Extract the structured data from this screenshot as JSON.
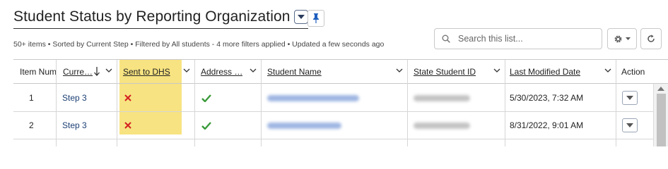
{
  "page": {
    "title": "Student Status by Reporting Organization",
    "subtitle": "50+ items • Sorted by Current Step • Filtered by All students - 4 more filters applied • Updated a few seconds ago"
  },
  "toolbar": {
    "search_placeholder": "Search this list..."
  },
  "columns": [
    {
      "label": "Item Num"
    },
    {
      "label": "Curre…"
    },
    {
      "label": "Sent to DHS"
    },
    {
      "label": "Address …"
    },
    {
      "label": "Student Name"
    },
    {
      "label": "State Student ID"
    },
    {
      "label": "Last Modified Date"
    },
    {
      "label": "Action"
    }
  ],
  "rows": [
    {
      "item": "1",
      "step": "Step 3",
      "sent_to_dhs": "no",
      "address_ok": "yes",
      "modified": "5/30/2023, 7:32 AM"
    },
    {
      "item": "2",
      "step": "Step 3",
      "sent_to_dhs": "no",
      "address_ok": "yes",
      "modified": "8/31/2022, 9:01 AM"
    }
  ],
  "colors": {
    "highlight": "#f7e27a",
    "link": "#1b3e74",
    "x_mark": "#d42020",
    "check_mark": "#3a9a3a"
  }
}
